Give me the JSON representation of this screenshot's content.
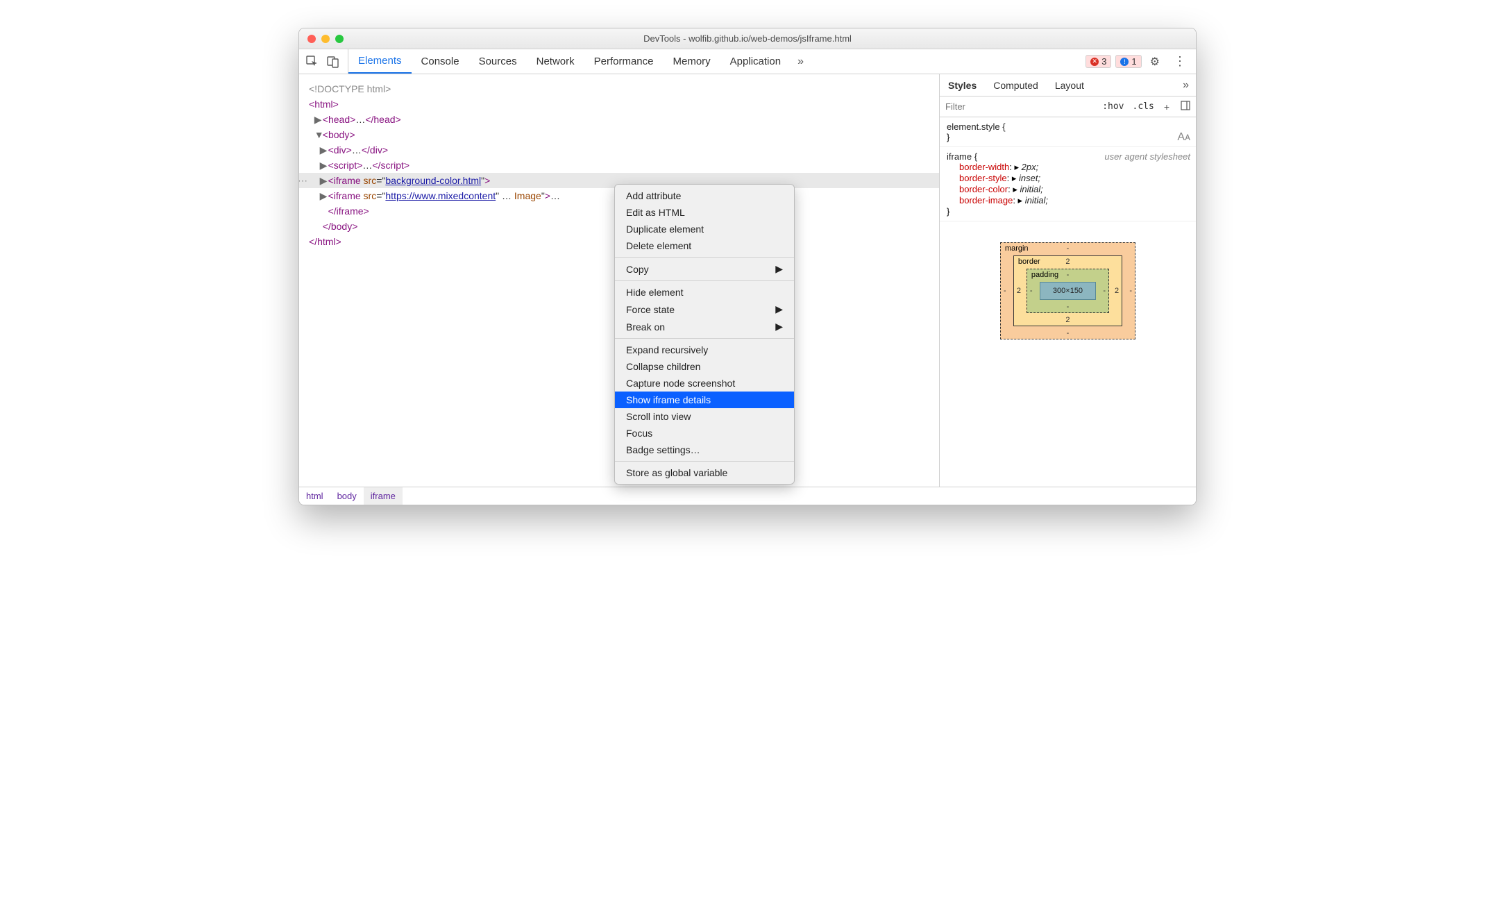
{
  "window": {
    "title": "DevTools - wolfib.github.io/web-demos/jsIframe.html"
  },
  "toolbar": {
    "tabs": [
      "Elements",
      "Console",
      "Sources",
      "Network",
      "Performance",
      "Memory",
      "Application"
    ],
    "active_tab": 0,
    "overflow_glyph": "»",
    "errors_count": "3",
    "issues_count": "1"
  },
  "dom": {
    "lines": [
      {
        "indent": 0,
        "raw": "<!DOCTYPE html>",
        "gray": true
      },
      {
        "indent": 0,
        "open": "html"
      },
      {
        "indent": 1,
        "tri": "▶",
        "open": "head",
        "ell": true,
        "close": "head"
      },
      {
        "indent": 1,
        "tri": "▼",
        "open": "body"
      },
      {
        "indent": 2,
        "tri": "▶",
        "open": "div",
        "ell": true,
        "close": "div"
      },
      {
        "indent": 2,
        "tri": "▶",
        "open": "script",
        "ell": true,
        "close": "script"
      },
      {
        "indent": 2,
        "tri": "▶",
        "open": "iframe",
        "attr": "src",
        "val": "background-color.html",
        "selected": true,
        "dots": true
      },
      {
        "indent": 2,
        "tri": "▶",
        "open": "iframe",
        "attr": "src",
        "val": "https://www.mixedcontent",
        "trail_attr": "Image",
        "ell_after": true
      },
      {
        "indent": 2,
        "closeline": "iframe"
      },
      {
        "indent": 1,
        "closeline": "body"
      },
      {
        "indent": 0,
        "closeline": "html"
      }
    ]
  },
  "breadcrumbs": [
    "html",
    "body",
    "iframe"
  ],
  "styles": {
    "tabs": [
      "Styles",
      "Computed",
      "Layout"
    ],
    "overflow_glyph": "»",
    "filter_placeholder": "Filter",
    "hov": ":hov",
    "cls": ".cls",
    "plus": "+",
    "rules": [
      {
        "selector": "element.style {",
        "close": "}",
        "aa": true
      },
      {
        "selector": "iframe {",
        "ua": "user agent stylesheet",
        "props": [
          {
            "k": "border-width",
            "v": "2px;"
          },
          {
            "k": "border-style",
            "v": "inset;"
          },
          {
            "k": "border-color",
            "v": "initial;"
          },
          {
            "k": "border-image",
            "v": "initial;"
          }
        ],
        "close": "}"
      }
    ],
    "box": {
      "margin": {
        "label": "margin",
        "t": "-",
        "r": "-",
        "b": "-",
        "l": "-"
      },
      "border": {
        "label": "border",
        "t": "2",
        "r": "2",
        "b": "2",
        "l": "2"
      },
      "padding": {
        "label": "padding",
        "t": "-",
        "r": "-",
        "b": "-",
        "l": "-"
      },
      "content": "300×150"
    }
  },
  "context_menu": {
    "groups": [
      [
        {
          "label": "Add attribute"
        },
        {
          "label": "Edit as HTML"
        },
        {
          "label": "Duplicate element"
        },
        {
          "label": "Delete element"
        }
      ],
      [
        {
          "label": "Copy",
          "submenu": true
        }
      ],
      [
        {
          "label": "Hide element"
        },
        {
          "label": "Force state",
          "submenu": true
        },
        {
          "label": "Break on",
          "submenu": true
        }
      ],
      [
        {
          "label": "Expand recursively"
        },
        {
          "label": "Collapse children"
        },
        {
          "label": "Capture node screenshot"
        },
        {
          "label": "Show iframe details",
          "highlight": true
        },
        {
          "label": "Scroll into view"
        },
        {
          "label": "Focus"
        },
        {
          "label": "Badge settings…"
        }
      ],
      [
        {
          "label": "Store as global variable"
        }
      ]
    ]
  }
}
